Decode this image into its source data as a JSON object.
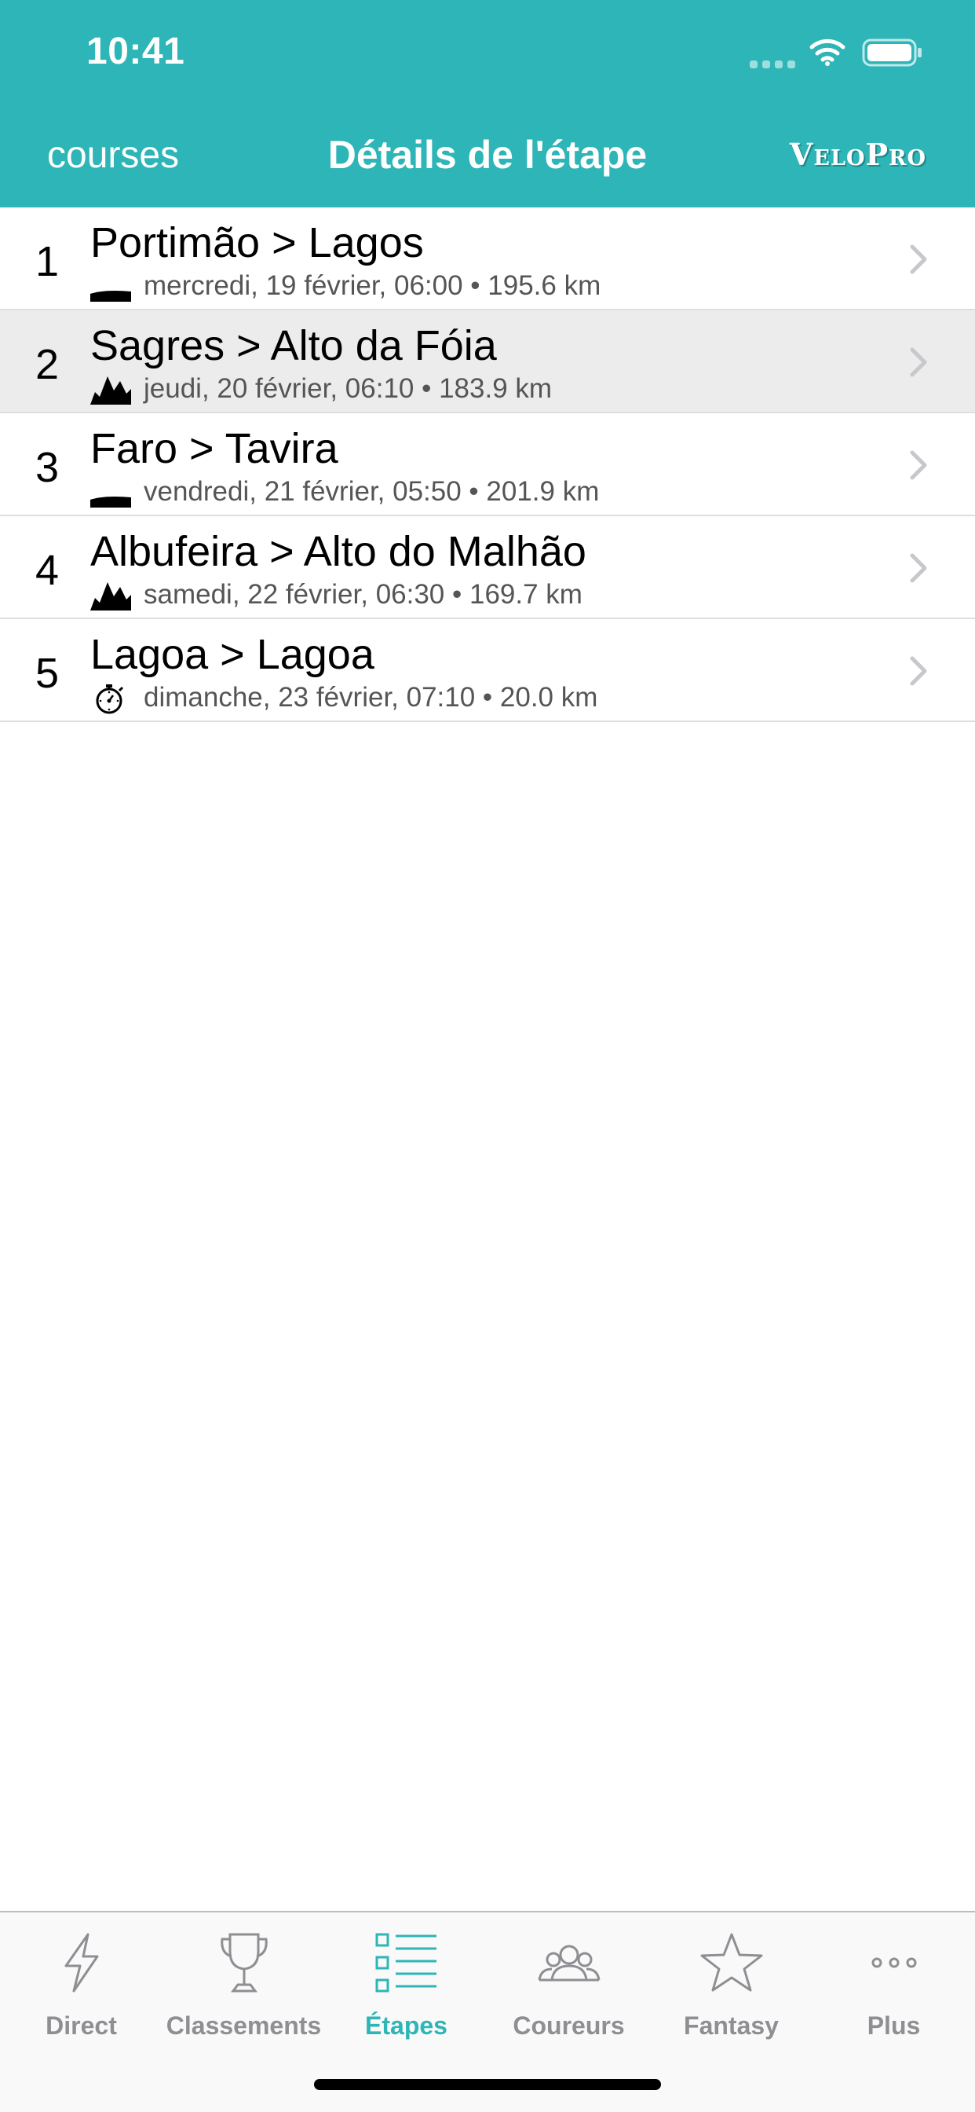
{
  "status_bar": {
    "time": "10:41"
  },
  "nav": {
    "back_label": "courses",
    "title": "Détails de l'étape",
    "logo_text": "VeloPro"
  },
  "stages": [
    {
      "number": "1",
      "route": "Portimão > Lagos",
      "meta": "mercredi, 19 février, 06:00 • 195.6 km",
      "profile_icon": "flat-profile-icon",
      "selected": false
    },
    {
      "number": "2",
      "route": "Sagres > Alto da Fóia",
      "meta": "jeudi, 20 février, 06:10 • 183.9 km",
      "profile_icon": "mountain-profile-icon",
      "selected": true
    },
    {
      "number": "3",
      "route": "Faro > Tavira",
      "meta": "vendredi, 21 février, 05:50 • 201.9 km",
      "profile_icon": "flat-profile-icon",
      "selected": false
    },
    {
      "number": "4",
      "route": "Albufeira > Alto do Malhão",
      "meta": "samedi, 22 février, 06:30 • 169.7 km",
      "profile_icon": "mountain-profile-icon",
      "selected": false
    },
    {
      "number": "5",
      "route": "Lagoa > Lagoa",
      "meta": "dimanche, 23 février, 07:10 • 20.0 km",
      "profile_icon": "stopwatch-icon",
      "selected": false
    }
  ],
  "tabbar": {
    "tabs": [
      {
        "label": "Direct",
        "icon": "lightning-icon",
        "active": false
      },
      {
        "label": "Classements",
        "icon": "trophy-icon",
        "active": false
      },
      {
        "label": "Étapes",
        "icon": "list-icon",
        "active": true
      },
      {
        "label": "Coureurs",
        "icon": "riders-icon",
        "active": false
      },
      {
        "label": "Fantasy",
        "icon": "star-icon",
        "active": false
      },
      {
        "label": "Plus",
        "icon": "more-dots-icon",
        "active": false
      }
    ]
  },
  "colors": {
    "accent": "#2db5b7",
    "selected_row": "#ececec",
    "inactive_tab": "#8e8e93"
  }
}
